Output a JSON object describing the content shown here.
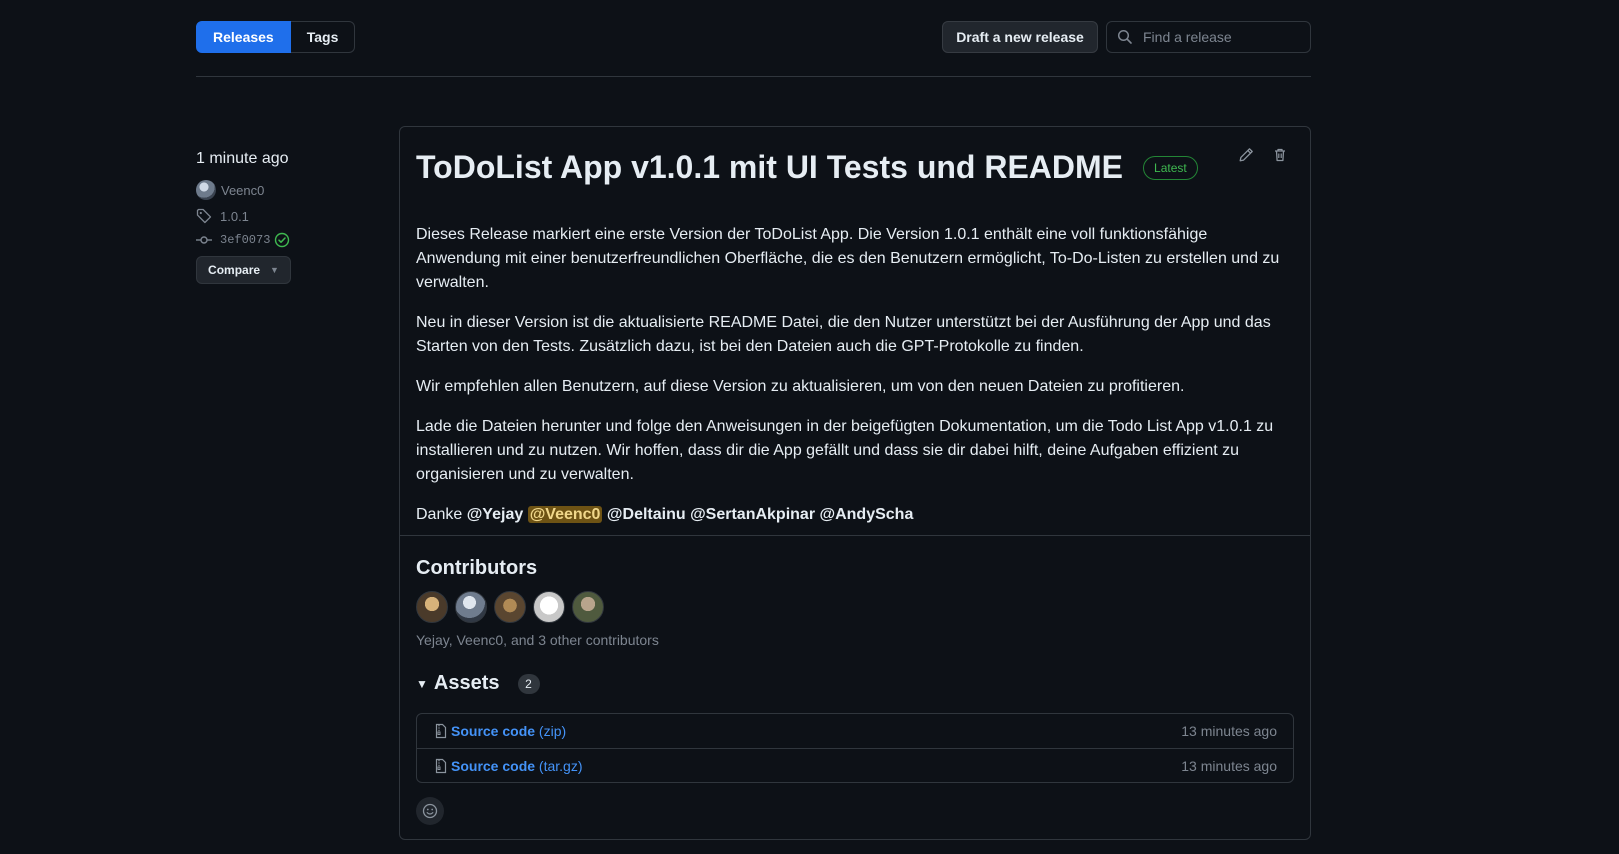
{
  "subnav": {
    "releases_label": "Releases",
    "tags_label": "Tags"
  },
  "toolbar": {
    "draft_label": "Draft a new release",
    "search_placeholder": "Find a release"
  },
  "meta": {
    "time": "1 minute ago",
    "author": "Veenc0",
    "tag": "1.0.1",
    "commit": "3ef0073",
    "compare_label": "Compare"
  },
  "release": {
    "title": "ToDoList App v1.0.1 mit UI Tests und README",
    "badge": "Latest",
    "paragraphs": [
      "Dieses Release markiert eine erste Version der ToDoList App. Die Version 1.0.1 enthält eine voll funktionsfähige Anwendung mit einer benutzerfreundlichen Oberfläche, die es den Benutzern ermöglicht, To-Do-Listen zu erstellen und zu verwalten.",
      "Neu in dieser Version ist die aktualisierte README Datei, die den Nutzer unterstützt bei der Ausführung der App und das Starten von den Tests. Zusätzlich dazu, ist bei den Dateien auch die GPT-Protokolle zu finden.",
      "Wir empfehlen allen Benutzern, auf diese Version zu aktualisieren, um von den neuen Dateien zu profitieren.",
      "Lade die Dateien herunter und folge den Anweisungen in der beigefügten Dokumentation, um die Todo List App v1.0.1 zu installieren und zu nutzen. Wir hoffen, dass dir die App gefällt und dass sie dir dabei hilft, deine Aufgaben effizient zu organisieren und zu verwalten."
    ],
    "thanks_prefix": "Danke",
    "mentions": [
      "@Yejay",
      "@Veenc0",
      "@Deltainu",
      "@SertanAkpinar",
      "@AndyScha"
    ]
  },
  "contributors": {
    "title": "Contributors",
    "summary": "Yejay, Veenc0, and 3 other contributors"
  },
  "assets": {
    "label": "Assets",
    "count": "2",
    "items": [
      {
        "name": "Source code",
        "ext": "(zip)",
        "time": "13 minutes ago"
      },
      {
        "name": "Source code",
        "ext": "(tar.gz)",
        "time": "13 minutes ago"
      }
    ]
  },
  "colors": {
    "accent": "#1f6feb",
    "link": "#4493f8",
    "success": "#3fb950",
    "background": "#0d1117"
  }
}
